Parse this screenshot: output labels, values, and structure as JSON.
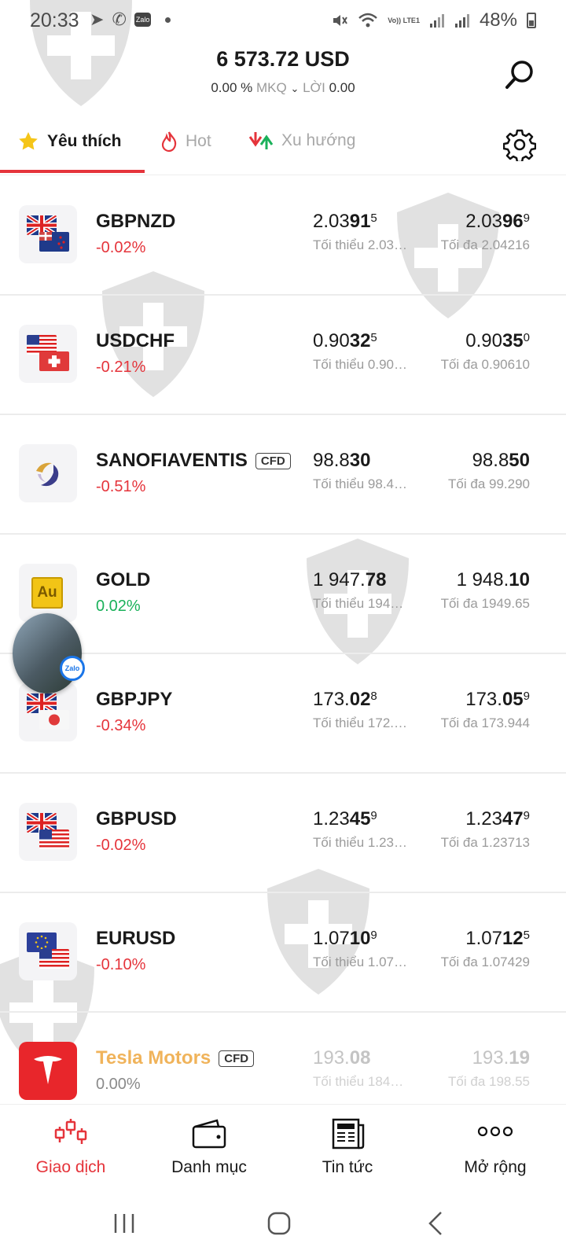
{
  "status_bar": {
    "time": "20:33",
    "zalo_badge": "Zalo",
    "lte_label": "Vo)) LTE1",
    "battery": "48%"
  },
  "header": {
    "balance": "6 573.72 USD",
    "change_percent": "0.00 %",
    "mkq_label": "MKQ",
    "profit_label": "LỜI",
    "profit_value": "0.00"
  },
  "tabs": [
    {
      "label": "Yêu thích",
      "icon": "star-icon",
      "active": true
    },
    {
      "label": "Hot",
      "icon": "fire-icon",
      "active": false
    },
    {
      "label": "Xu hướng",
      "icon": "trend-arrows-icon",
      "active": false
    }
  ],
  "instruments": [
    {
      "symbol": "GBPNZD",
      "change": "-0.02%",
      "dir": "neg",
      "bid_pre": "2.03",
      "bid_big": "91",
      "bid_sup": "5",
      "ask_pre": "2.03",
      "ask_big": "96",
      "ask_sup": "9",
      "min": "Tối thiểu 2.03…",
      "max": "Tối đa 2.04216",
      "icon": "gb-nz-flags"
    },
    {
      "symbol": "USDCHF",
      "change": "-0.21%",
      "dir": "neg",
      "bid_pre": "0.90",
      "bid_big": "32",
      "bid_sup": "5",
      "ask_pre": "0.90",
      "ask_big": "35",
      "ask_sup": "0",
      "min": "Tối thiểu 0.90…",
      "max": "Tối đa 0.90610",
      "icon": "us-ch-flags"
    },
    {
      "symbol": "SANOFIAVENTIS",
      "cfd": "CFD",
      "change": "-0.51%",
      "dir": "neg",
      "bid_pre": "98.8",
      "bid_big": "30",
      "bid_sup": "",
      "ask_pre": "98.8",
      "ask_big": "50",
      "ask_sup": "",
      "min": "Tối thiểu 98.4…",
      "max": "Tối đa 99.290",
      "icon": "sanofi-logo"
    },
    {
      "symbol": "GOLD",
      "change": "0.02%",
      "dir": "pos",
      "bid_pre": "1 947.",
      "bid_big": "78",
      "bid_sup": "",
      "ask_pre": "1 948.",
      "ask_big": "10",
      "ask_sup": "",
      "min": "Tối thiểu 194…",
      "max": "Tối đa 1949.65",
      "icon": "gold-au",
      "icon_text": "Au"
    },
    {
      "symbol": "GBPJPY",
      "change": "-0.34%",
      "dir": "neg",
      "bid_pre": "173.",
      "bid_big": "02",
      "bid_sup": "8",
      "ask_pre": "173.",
      "ask_big": "05",
      "ask_sup": "9",
      "min": "Tối thiểu 172.…",
      "max": "Tối đa 173.944",
      "icon": "gb-jp-flags"
    },
    {
      "symbol": "GBPUSD",
      "change": "-0.02%",
      "dir": "neg",
      "bid_pre": "1.23",
      "bid_big": "45",
      "bid_sup": "9",
      "ask_pre": "1.23",
      "ask_big": "47",
      "ask_sup": "9",
      "min": "Tối thiểu 1.23…",
      "max": "Tối đa 1.23713",
      "icon": "gb-us-flags"
    },
    {
      "symbol": "EURUSD",
      "change": "-0.10%",
      "dir": "neg",
      "bid_pre": "1.07",
      "bid_big": "10",
      "bid_sup": "9",
      "ask_pre": "1.07",
      "ask_big": "12",
      "ask_sup": "5",
      "min": "Tối thiểu 1.07…",
      "max": "Tối đa 1.07429",
      "icon": "eu-us-flags"
    },
    {
      "symbol": "Tesla Motors",
      "cfd": "CFD",
      "change": "0.00%",
      "dir": "zero",
      "bid_pre": "193.",
      "bid_big": "08",
      "bid_sup": "",
      "ask_pre": "193.",
      "ask_big": "19",
      "ask_sup": "",
      "min": "Tối thiểu 184…",
      "max": "Tối đa 198.55",
      "icon": "tesla-logo"
    }
  ],
  "floating_bubble": {
    "badge": "Zalo"
  },
  "bottom_nav": [
    {
      "label": "Giao dịch",
      "icon": "candlestick-icon",
      "active": true
    },
    {
      "label": "Danh mục",
      "icon": "wallet-icon",
      "active": false
    },
    {
      "label": "Tin tức",
      "icon": "newspaper-icon",
      "active": false
    },
    {
      "label": "Mở rộng",
      "icon": "more-dots-icon",
      "active": false
    }
  ],
  "colors": {
    "accent_red": "#e5343b",
    "positive_green": "#1ab15a",
    "muted_gray": "#9b9b9b",
    "tesla_label": "#f0b35a"
  }
}
